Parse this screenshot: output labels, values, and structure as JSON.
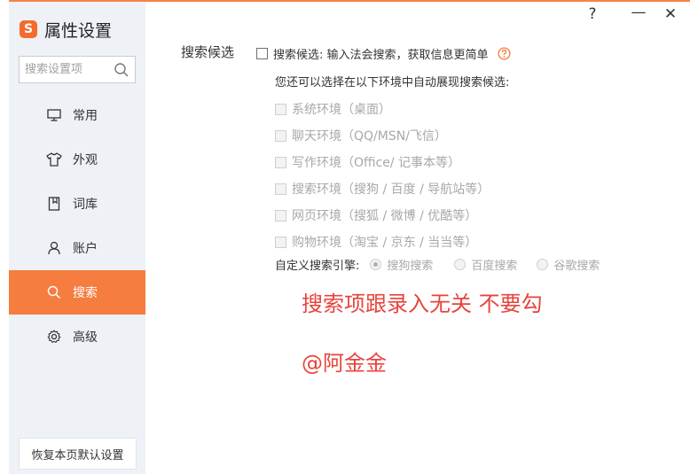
{
  "brand": {
    "title": "属性设置",
    "logo_char": "S"
  },
  "window_controls": {
    "help": "?",
    "minimize": "—",
    "close": "✕"
  },
  "search": {
    "placeholder": "搜索设置项"
  },
  "nav": {
    "items": [
      {
        "label": "常用",
        "icon": "monitor-icon"
      },
      {
        "label": "外观",
        "icon": "shirt-icon"
      },
      {
        "label": "词库",
        "icon": "book-icon"
      },
      {
        "label": "账户",
        "icon": "user-icon"
      },
      {
        "label": "搜索",
        "icon": "search-icon",
        "active": true
      },
      {
        "label": "高级",
        "icon": "gear-icon"
      }
    ]
  },
  "restore_button": "恢复本页默认设置",
  "section": {
    "label": "搜索候选",
    "main_checkbox": {
      "label": "搜索候选: 输入法会搜索，获取信息更简单",
      "checked": false
    },
    "description": "您还可以选择在以下环境中自动展现搜索候选:",
    "environments": [
      "系统环境（桌面）",
      "聊天环境（QQ/MSN/飞信）",
      "写作环境（Office/ 记事本等）",
      "搜索环境（搜狗 / 百度 / 导航站等）",
      "网页环境（搜狐 / 微博 / 优酷等）",
      "购物环境（淘宝 / 京东 / 当当等）"
    ],
    "engine": {
      "label": "自定义搜索引擎:",
      "options": [
        {
          "label": "搜狗搜索",
          "selected": true
        },
        {
          "label": "百度搜索",
          "selected": false
        },
        {
          "label": "谷歌搜索",
          "selected": false
        }
      ]
    }
  },
  "annotations": {
    "line1": "搜索项跟录入无关 不要勾",
    "line2": "@阿金金"
  },
  "colors": {
    "accent": "#f57d3f",
    "annotation": "#e8433c",
    "sidebar_bg": "#eef1f5"
  }
}
